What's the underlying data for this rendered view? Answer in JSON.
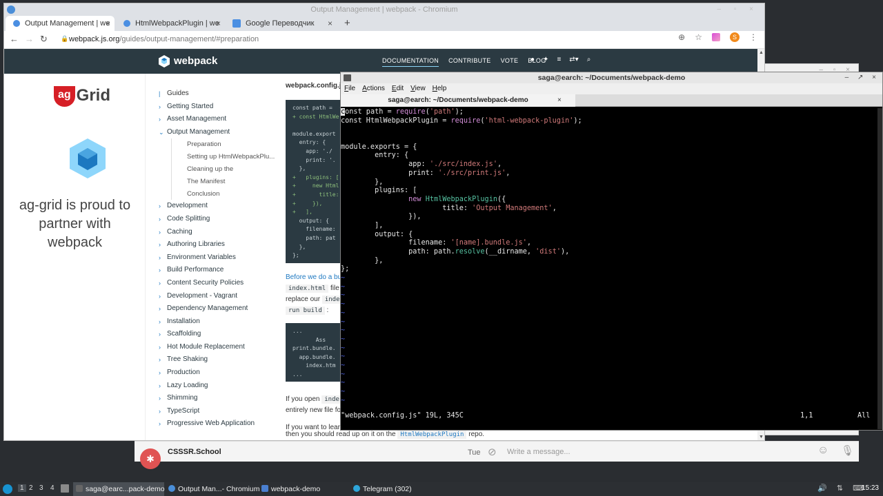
{
  "browser": {
    "window_title": "Output Management | webpack - Chromium",
    "tabs": [
      {
        "label": "Output Management | we"
      },
      {
        "label": "HtmlWebpackPlugin | we"
      },
      {
        "label": "Google Переводчик"
      }
    ],
    "url_host": "webpack.js.org",
    "url_path": "/guides/output-management/#preparation",
    "profile_initial": "S"
  },
  "site": {
    "logo_text": "webpack",
    "nav": [
      "DOCUMENTATION",
      "CONTRIBUTE",
      "VOTE",
      "BLOG"
    ]
  },
  "ad": {
    "badge": "ag",
    "brand": "Grid",
    "text": "ag-grid is proud to partner with webpack"
  },
  "sidebar": {
    "guides": "Guides",
    "items_before": [
      "Getting Started",
      "Asset Management"
    ],
    "current": "Output Management",
    "sub": [
      "Preparation",
      "Setting up HtmlWebpackPlu...",
      "Cleaning up the",
      "The Manifest",
      "Conclusion"
    ],
    "items_after": [
      "Development",
      "Code Splitting",
      "Caching",
      "Authoring Libraries",
      "Environment Variables",
      "Build Performance",
      "Content Security Policies",
      "Development - Vagrant",
      "Dependency Management",
      "Installation",
      "Scaffolding",
      "Hot Module Replacement",
      "Tree Shaking",
      "Production",
      "Lazy Loading",
      "Shimming",
      "TypeScript",
      "Progressive Web Application"
    ]
  },
  "content": {
    "config_name": "webpack.config.j",
    "code1": [
      "const path =",
      "+ const HtmlWe",
      "",
      "module.export",
      "  entry: {",
      "    app: './",
      "    print: '.",
      "  },",
      "+   plugins: [",
      "+     new Html",
      "+       title:",
      "+     }),",
      "+   ],",
      "  output: {",
      "    filename:",
      "    path: pat",
      "  },",
      "};"
    ],
    "para1_a": "Before we do a bu",
    "para1_code1": "index.html",
    "para1_b": "file",
    "para1_c": "replace our",
    "para1_code2": "inde",
    "para1_code3": "run build",
    "code2": [
      "...",
      "       Ass",
      "print.bundle.",
      "  app.bundle.",
      "    index.htm",
      "..."
    ],
    "para2_a": "If you open",
    "para2_code": "inde",
    "para2_b": "entirely new file fo",
    "para3_a": "If you want to lear",
    "para3_b": "then you should read up on it on the",
    "para3_code": "HtmlWebpackPlugin",
    "para3_c": "repo."
  },
  "terminal": {
    "title": "saga@earch: ~/Documents/webpack-demo",
    "menu": [
      "File",
      "Actions",
      "Edit",
      "View",
      "Help"
    ],
    "tab_label": "saga@earch: ~/Documents/webpack-demo",
    "status_file": "\"webpack.config.js\" 19L, 345C",
    "status_pos": "1,1",
    "status_all": "All"
  },
  "telegram": {
    "chat": "CSSSR.School",
    "day": "Tue",
    "placeholder": "Write a message..."
  },
  "taskbar": {
    "workspaces": [
      "1",
      "2",
      "3",
      "4"
    ],
    "tasks": [
      "saga@earc...pack-demo",
      "Output Man...- Chromium",
      "webpack-demo",
      "Telegram (302)"
    ],
    "clock": "15:23"
  }
}
